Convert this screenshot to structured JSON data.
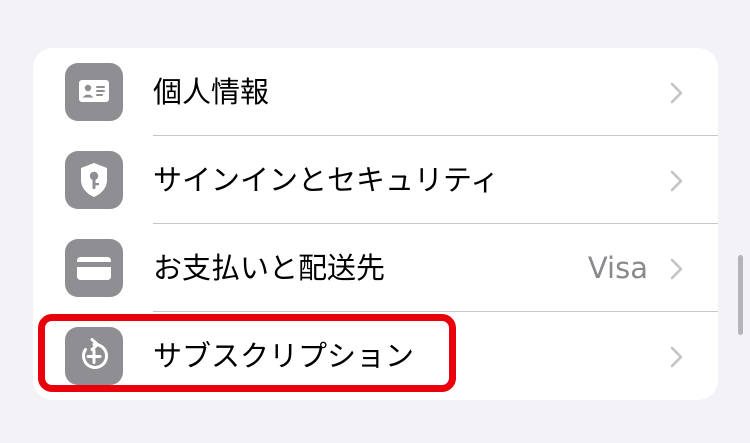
{
  "settings_list": {
    "items": [
      {
        "id": "personal-info",
        "label": "個人情報",
        "detail": "",
        "icon": "id-card-icon"
      },
      {
        "id": "signin-security",
        "label": "サインインとセキュリティ",
        "detail": "",
        "icon": "shield-key-icon"
      },
      {
        "id": "payment-shipping",
        "label": "お支払いと配送先",
        "detail": "Visa",
        "icon": "credit-card-icon"
      },
      {
        "id": "subscriptions",
        "label": "サブスクリプション",
        "detail": "",
        "icon": "subscription-add-icon"
      }
    ]
  },
  "colors": {
    "background": "#f2f2f7",
    "card": "#ffffff",
    "icon_tile": "#8e8e93",
    "highlight": "#e8000b",
    "detail_text": "#8a8a8e",
    "chevron": "#c4c4c7"
  }
}
